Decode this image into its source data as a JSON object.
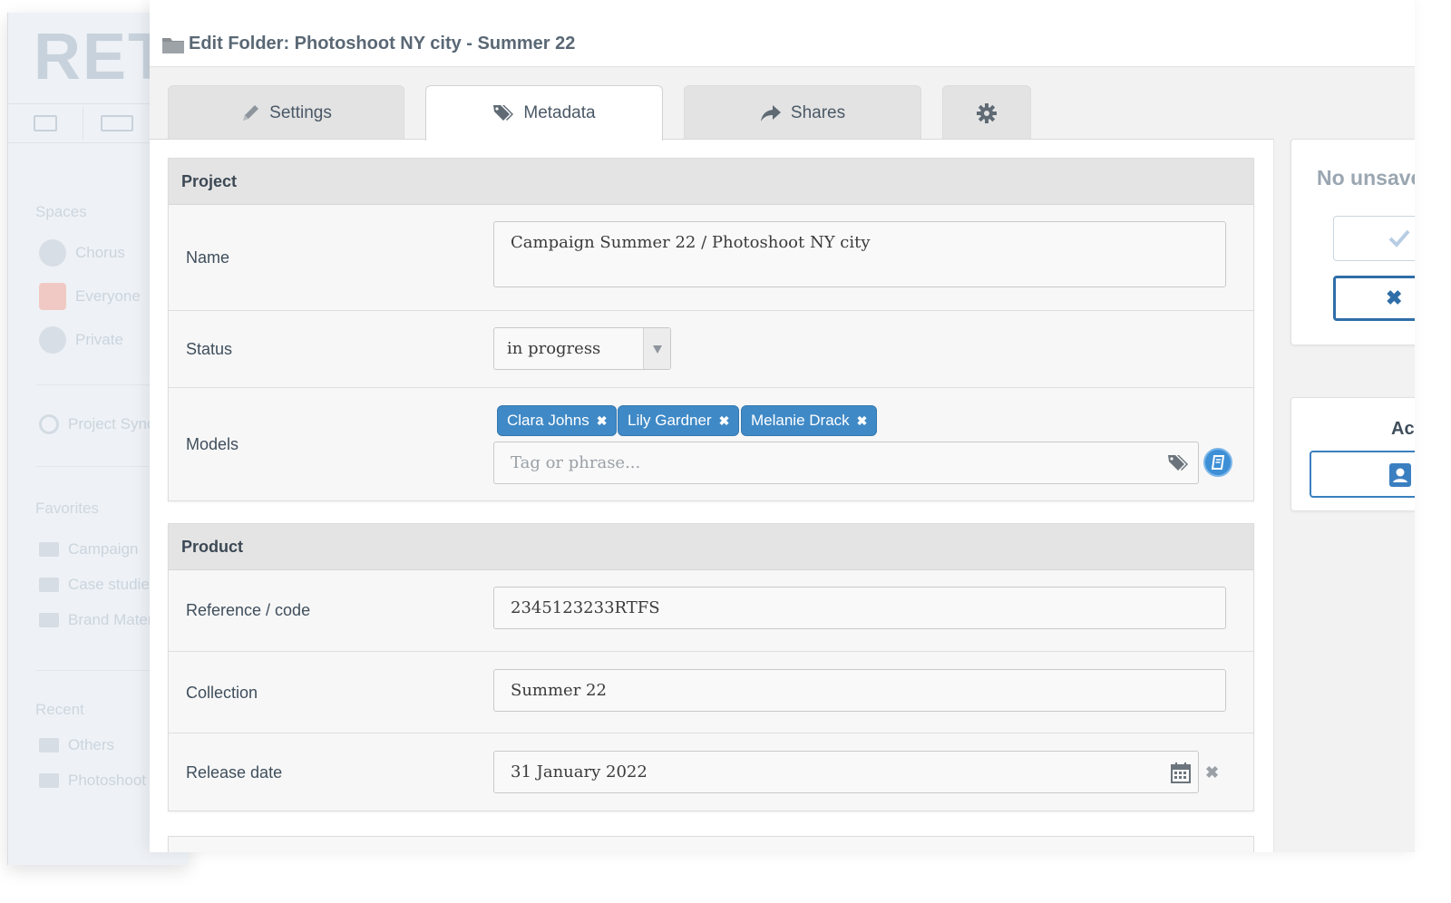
{
  "background_app": {
    "logo": "RETA",
    "spaces_heading": "Spaces",
    "spaces": [
      "Chorus",
      "Everyone",
      "Private"
    ],
    "sync_item": "Project Sync",
    "favorites_heading": "Favorites",
    "favorites": [
      "Campaign",
      "Case studies",
      "Brand Mater"
    ],
    "recent_heading": "Recent",
    "recent": [
      "Others",
      "Photoshoot"
    ]
  },
  "dialog": {
    "title": "Edit Folder: Photoshoot NY city - Summer 22",
    "tabs": [
      {
        "label": "Settings",
        "icon": "pencil-icon"
      },
      {
        "label": "Metadata",
        "icon": "tags-icon",
        "active": true
      },
      {
        "label": "Shares",
        "icon": "share-arrow-icon"
      },
      {
        "label": "",
        "icon": "gear-icon"
      }
    ]
  },
  "project": {
    "heading": "Project",
    "name_label": "Name",
    "name_value": "Campaign Summer 22 / Photoshoot NY city",
    "status_label": "Status",
    "status_value": "in progress",
    "models_label": "Models",
    "models_tags": [
      "Clara Johns",
      "Lily Gardner",
      "Melanie Drack"
    ],
    "models_placeholder": "Tag or phrase..."
  },
  "product": {
    "heading": "Product",
    "reference_label": "Reference / code",
    "reference_value": "2345123233RTFS",
    "collection_label": "Collection",
    "collection_value": "Summer 22",
    "release_label": "Release date",
    "release_value": "31 January 2022"
  },
  "sidebar_right": {
    "status_text": "No unsave",
    "actions_title": "Act"
  },
  "colors": {
    "accent": "#3f89c6",
    "chip_text": "#ffffff",
    "cancel_border": "#2f6ea8"
  }
}
